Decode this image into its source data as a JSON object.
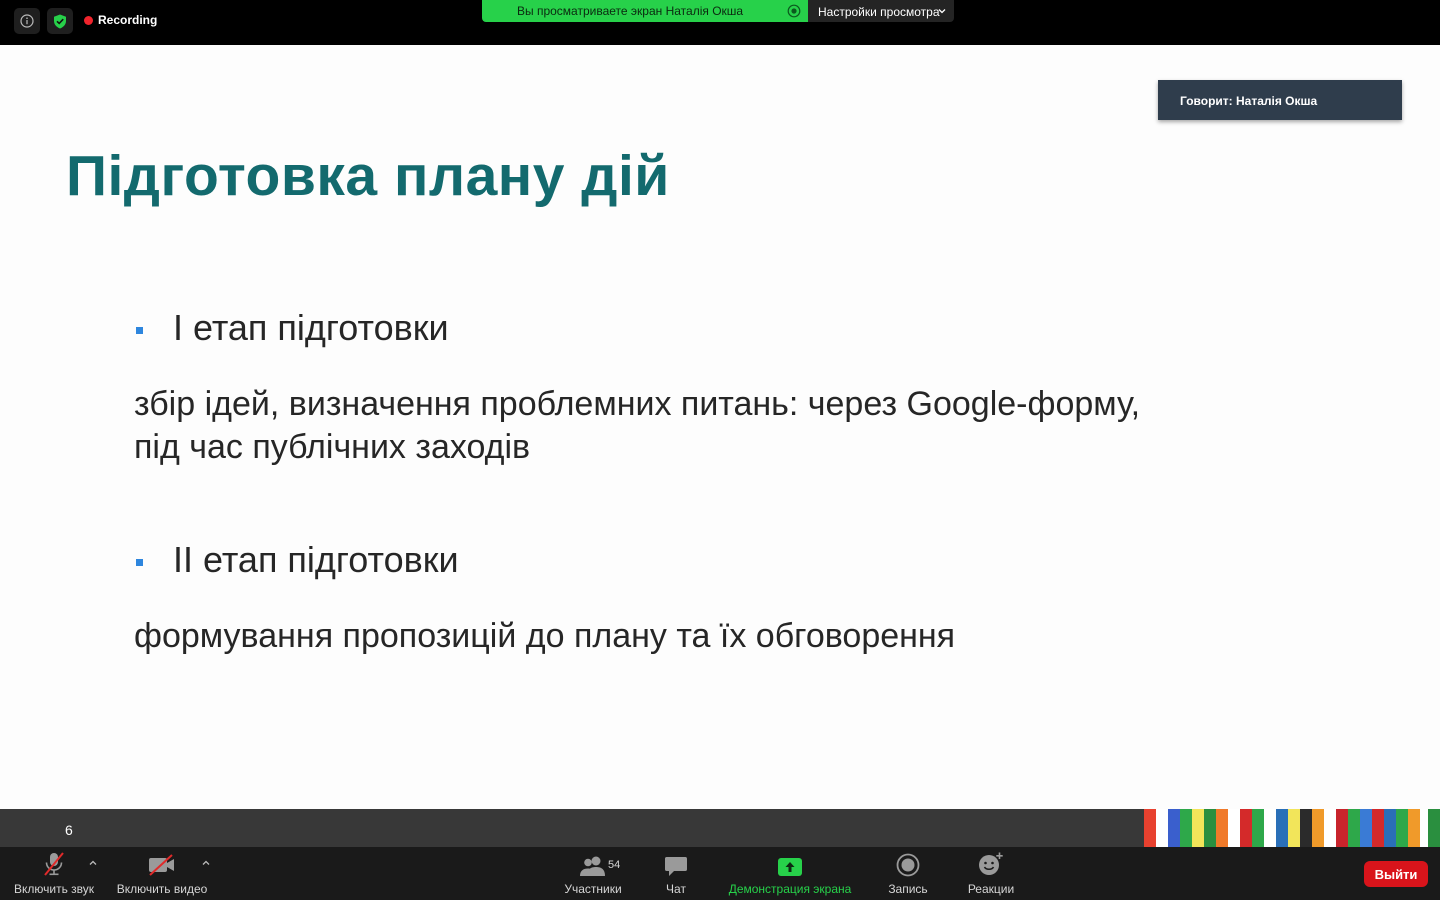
{
  "topbar": {
    "recording_label": "Recording",
    "share_banner_text": "Вы просматриваете экран Наталія Окша",
    "view_options_label": "Настройки просмотра"
  },
  "colors": {
    "share_green": "#27d14a",
    "recording_red": "#f0242c",
    "title_teal": "#136a6e",
    "bullet_blue": "#2e86de",
    "leave_red": "#d9141b"
  },
  "speaker_label": "Говорит: Наталія Окша",
  "slide": {
    "title": "Підготовка плану дій",
    "stages": [
      {
        "heading": "І етап підготовки",
        "description_lines": [
          "збір ідей, визначення проблемних питань: через Google-форму,",
          "під час публічних заходів"
        ]
      },
      {
        "heading": "ІІ етап підготовки",
        "description_lines": [
          "формування пропозицій до плану та їх обговорення"
        ]
      }
    ],
    "slide_number": "6"
  },
  "toolbar": {
    "unmute_label": "Включить звук",
    "start_video_label": "Включить видео",
    "participants_label": "Участники",
    "participants_count": "54",
    "chat_label": "Чат",
    "share_screen_label": "Демонстрация экрана",
    "record_label": "Запись",
    "reactions_label": "Реакции",
    "leave_label": "Выйти"
  },
  "icons": [
    "info-icon",
    "shield-check-icon",
    "recording-dot-icon",
    "stop-share-icon",
    "chevron-down-icon",
    "mic-off-icon",
    "video-off-icon",
    "caret-up-icon",
    "participants-icon",
    "chat-icon",
    "share-screen-icon",
    "record-icon",
    "reactions-icon"
  ]
}
